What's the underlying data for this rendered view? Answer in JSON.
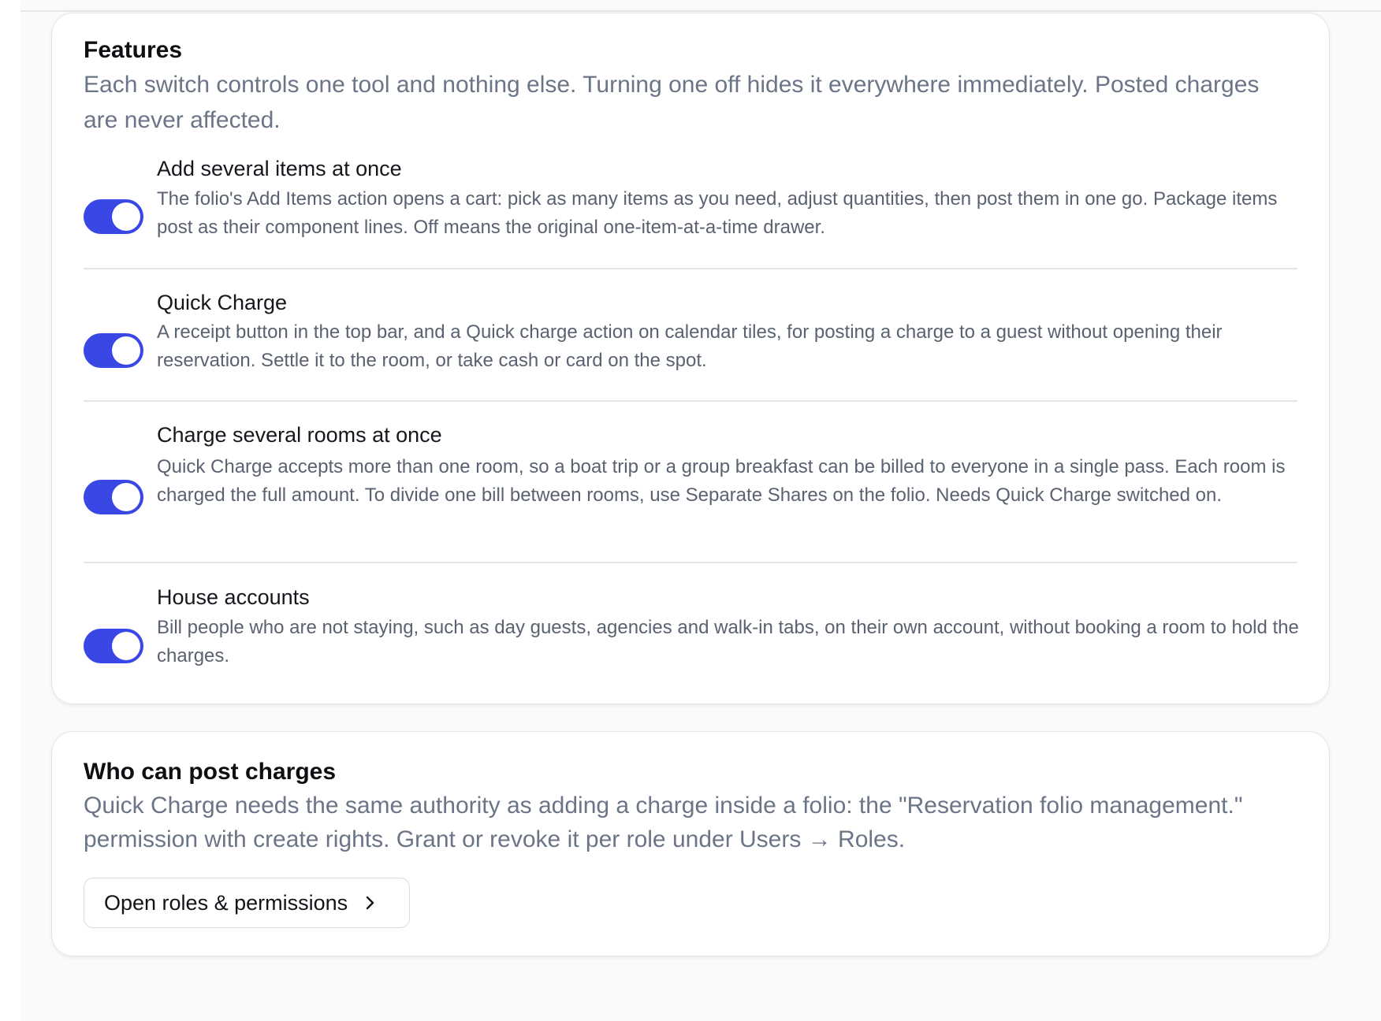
{
  "features": {
    "title": "Features",
    "description": "Each switch controls one tool and nothing else. Turning one off hides it everywhere immediately. Posted charges are never affected.",
    "items": [
      {
        "title": "Add several items at once",
        "description": "The folio's Add Items action opens a cart: pick as many items as you need, adjust quantities, then post them in one go. Package items post as their component lines. Off means the original one-item-at-a-time drawer.",
        "enabled": true
      },
      {
        "title": "Quick Charge",
        "description": "A receipt button in the top bar, and a Quick charge action on calendar tiles, for posting a charge to a guest without opening their reservation. Settle it to the room, or take cash or card on the spot.",
        "enabled": true
      },
      {
        "title": "Charge several rooms at once",
        "description": "Quick Charge accepts more than one room, so a boat trip or a group breakfast can be billed to everyone in a single pass. Each room is charged the full amount. To divide one bill between rooms, use Separate Shares on the folio. Needs Quick Charge switched on.",
        "enabled": true
      },
      {
        "title": "House accounts",
        "description": "Bill people who are not staying, such as day guests, agencies and walk-in tabs, on their own account, without booking a room to hold the charges.",
        "enabled": true
      }
    ]
  },
  "permissions": {
    "title": "Who can post charges",
    "description": "Quick Charge needs the same authority as adding a charge inside a folio: the \"Reservation folio management.\" permission with create rights. Grant or revoke it per role under Users → Roles.",
    "button_label": "Open roles & permissions"
  },
  "colors": {
    "toggle_on": "#3947e5",
    "muted_text": "#6b7587"
  },
  "icons": {
    "button_icon": "chevron-right-icon"
  }
}
